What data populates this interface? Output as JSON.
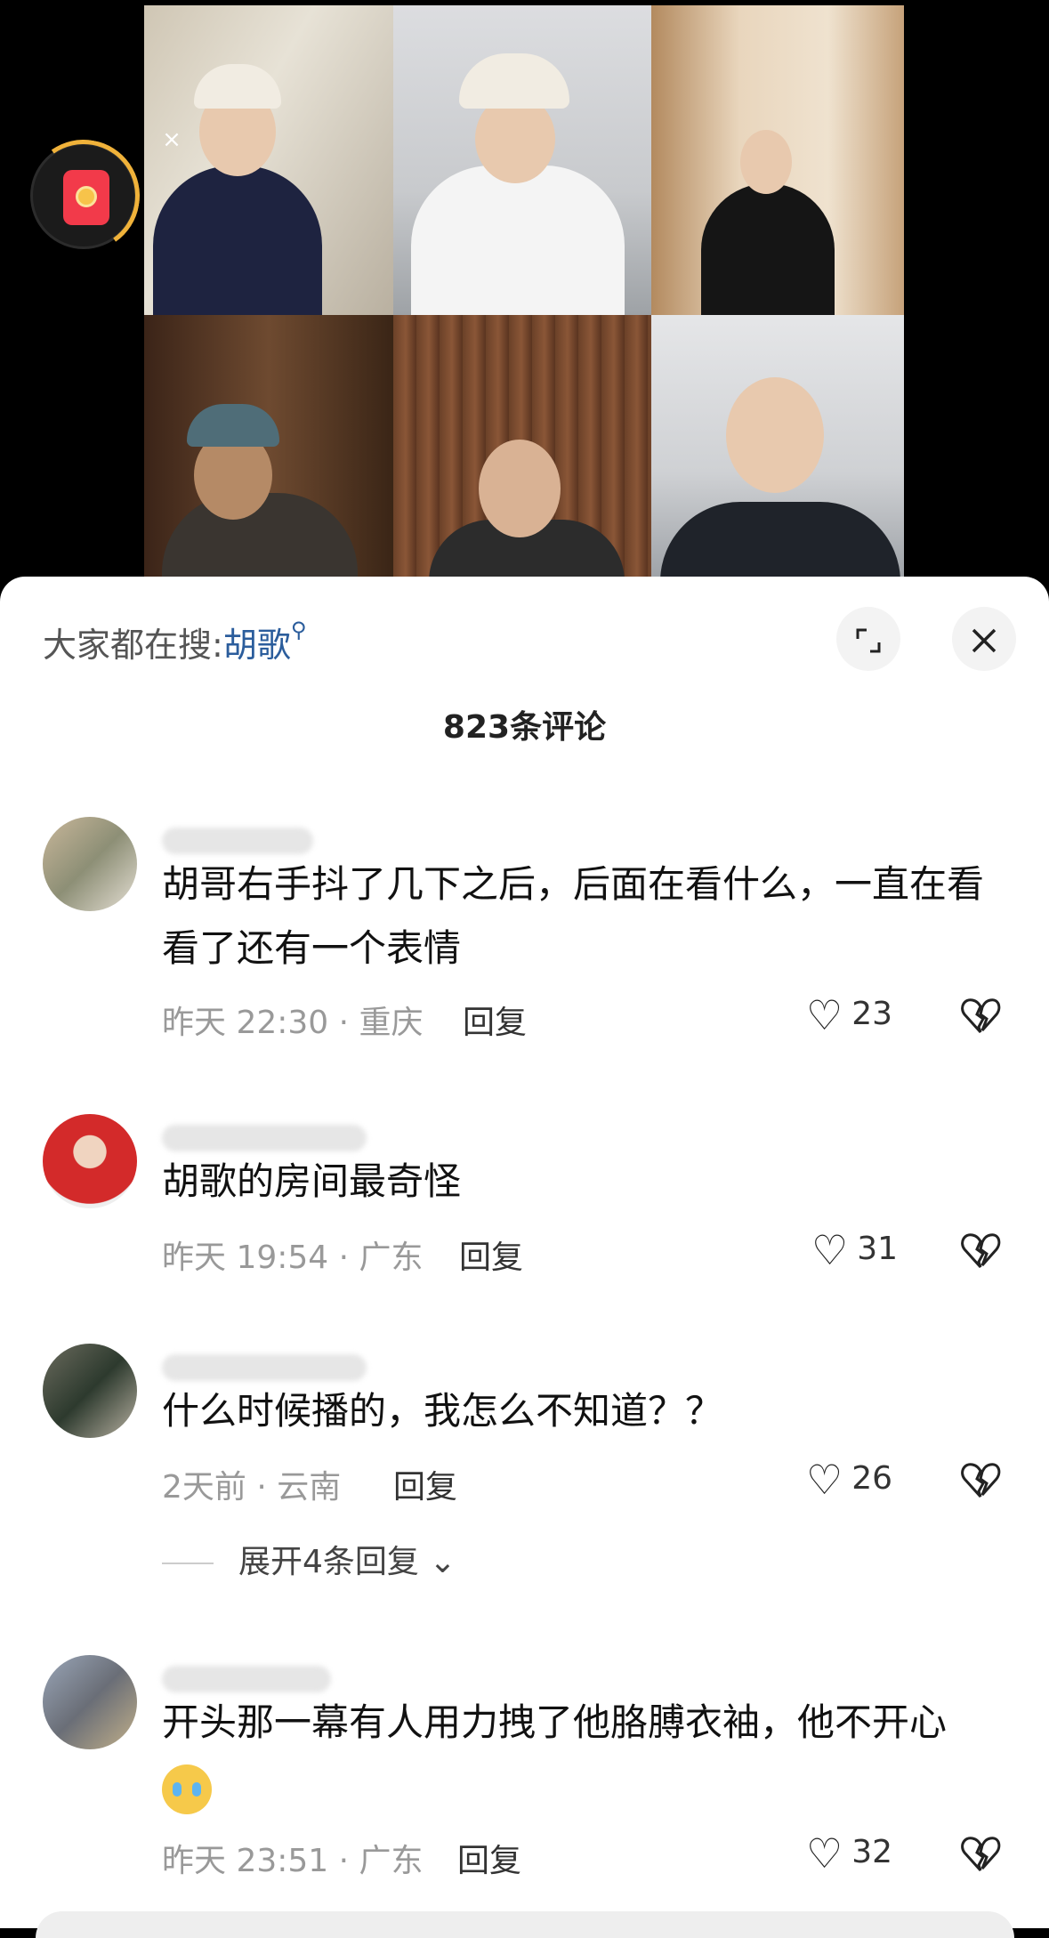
{
  "search": {
    "prefix": "大家都在搜:",
    "keyword": "胡歌"
  },
  "comment_count": "823条评论",
  "comments": [
    {
      "text": "胡哥右手抖了几下之后，后面在看什么，一直在看看了还有一个表情",
      "time": "昨天 22:30",
      "location": "重庆",
      "reply_label": "回复",
      "likes": "23"
    },
    {
      "text": "胡歌的房间最奇怪",
      "time": "昨天 19:54",
      "location": "广东",
      "reply_label": "回复",
      "likes": "31"
    },
    {
      "text": "什么时候播的，我怎么不知道？？",
      "time": "2天前",
      "location": "云南",
      "reply_label": "回复",
      "likes": "26",
      "expand_label": "展开4条回复"
    },
    {
      "text": "开头那一幕有人用力拽了他胳膊衣袖，他不开心",
      "time": "昨天 23:51",
      "location": "广东",
      "reply_label": "回复",
      "likes": "32"
    }
  ],
  "icons": {
    "red_packet": "red-envelope-icon",
    "expand": "expand-icon",
    "close": "close-icon",
    "like": "heart-icon",
    "dislike": "broken-heart-icon"
  },
  "colors": {
    "search_keyword": "#2b5d9c",
    "meta_text": "#999999",
    "red_packet": "#f23a4a",
    "timer_ring": "#f0b23a"
  }
}
